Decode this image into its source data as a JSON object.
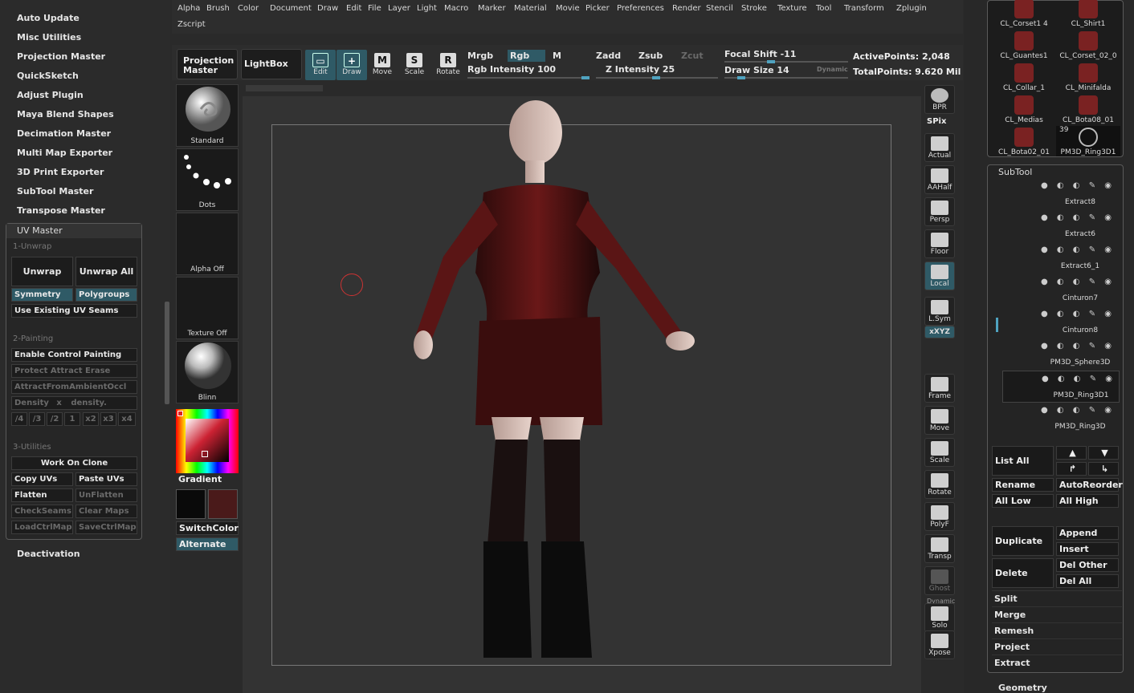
{
  "plugins": {
    "items": [
      "Auto Update",
      "Misc Utilities",
      "Projection Master",
      "QuickSketch",
      "Adjust Plugin",
      "Maya Blend Shapes",
      "Decimation Master",
      "Multi Map Exporter",
      "3D Print Exporter",
      "SubTool Master",
      "Transpose Master"
    ],
    "deactivation": "Deactivation"
  },
  "uvmaster": {
    "title": "UV Master",
    "sec1": "1-Unwrap",
    "unwrap": "Unwrap",
    "unwrap_all": "Unwrap All",
    "symmetry": "Symmetry",
    "polygroups": "Polygroups",
    "use_existing": "Use Existing UV Seams",
    "sec2": "2-Painting",
    "enable_control": "Enable Control Painting",
    "protect": "Protect Attract Erase",
    "attract_ambient": "AttractFromAmbientOccl",
    "density": "Density",
    "density_x": "x",
    "density_slider": "density.",
    "div": [
      "/4",
      "/3",
      "/2",
      "1",
      "x2",
      "x3",
      "x4"
    ],
    "sec3": "3-Utilities",
    "work_clone": "Work On Clone",
    "copy_uvs": "Copy UVs",
    "paste_uvs": "Paste UVs",
    "flatten": "Flatten",
    "unflatten": "UnFlatten",
    "checkseams": "CheckSeams",
    "clear_maps": "Clear Maps",
    "load_ctrl": "LoadCtrlMap",
    "save_ctrl": "SaveCtrlMap"
  },
  "menu": {
    "row1": [
      "Alpha",
      "Brush",
      "Color",
      "Document",
      "Draw",
      "Edit",
      "File",
      "Layer",
      "Light",
      "Macro",
      "Marker",
      "Material",
      "Movie",
      "Picker",
      "Preferences",
      "Render",
      "Stencil",
      "Stroke",
      "Texture",
      "Tool",
      "Transform",
      "Zplugin"
    ],
    "row2": [
      "Zscript"
    ]
  },
  "toolbar": {
    "projection_master": "Projection Master",
    "lightbox": "LightBox",
    "edit": "Edit",
    "draw": "Draw",
    "move": "Move",
    "scale": "Scale",
    "rotate": "Rotate",
    "mrgb": "Mrgb",
    "rgb": "Rgb",
    "m": "M",
    "rgb_intensity": "Rgb Intensity 100",
    "zadd": "Zadd",
    "zsub": "Zsub",
    "zcut": "Zcut",
    "z_intensity": "Z Intensity 25",
    "focal_shift": "Focal Shift -11",
    "draw_size": "Draw Size 14",
    "dynamic": "Dynamic",
    "active_points": "ActivePoints: 2,048",
    "total_points": "TotalPoints: 9.620 Mil",
    "rgb_intensity_value": 100,
    "z_intensity_value": 25,
    "focal_shift_value": -11,
    "draw_size_value": 14
  },
  "materials": {
    "standard": "Standard",
    "dots": "Dots",
    "alpha_off": "Alpha Off",
    "texture_off": "Texture Off",
    "blinn": "Blinn",
    "gradient": "Gradient",
    "switchcolor": "SwitchColor",
    "alternate": "Alternate",
    "primary_color": "#0a0a0a",
    "secondary_color": "#4a1a1a"
  },
  "rdock": {
    "bpr": "BPR",
    "spix": "SPix",
    "actual": "Actual",
    "aahalf": "AAHalf",
    "persp": "Persp",
    "floor": "Floor",
    "local": "Local",
    "lsym": "L.Sym",
    "xyz": "xXYZ",
    "frame": "Frame",
    "move": "Move",
    "scale": "Scale",
    "rotate": "Rotate",
    "polyf": "PolyF",
    "transp": "Transp",
    "ghost": "Ghost",
    "dynamic": "Dynamic",
    "solo": "Solo",
    "xpose": "Xpose"
  },
  "thumbs": {
    "items": [
      "CL_Corset1 4",
      "CL_Shirt1",
      "CL_Guantes1",
      "CL_Corset_02_0",
      "CL_Collar_1",
      "CL_Minifalda",
      "CL_Medias",
      "CL_Bota08_01",
      "CL_Bota02_01",
      "PM3D_Ring3D1"
    ],
    "count": "39"
  },
  "subtool": {
    "title": "SubTool",
    "items": [
      "Extract8",
      "Extract6",
      "Extract6_1",
      "Cinturon7",
      "Cinturon8",
      "PM3D_Sphere3D",
      "PM3D_Ring3D1",
      "PM3D_Ring3D"
    ],
    "list_all": "List All",
    "rename": "Rename",
    "autoreorder": "AutoReorder",
    "all_low": "All Low",
    "all_high": "All High",
    "duplicate": "Duplicate",
    "append": "Append",
    "insert": "Insert",
    "delete": "Delete",
    "del_other": "Del Other",
    "del_all": "Del All",
    "split": "Split",
    "merge": "Merge",
    "remesh": "Remesh",
    "project": "Project",
    "extract": "Extract",
    "geometry": "Geometry"
  },
  "icons": [
    "bpr-icon",
    "actual-icon",
    "aahalf-icon",
    "persp-icon",
    "floor-icon",
    "local-icon",
    "lsym-icon",
    "frame-icon",
    "move-icon",
    "scale-icon",
    "rotate-icon",
    "polyf-icon",
    "transp-icon",
    "ghost-icon",
    "solo-icon",
    "xpose-icon",
    "arrow-up-icon",
    "arrow-down-icon"
  ]
}
